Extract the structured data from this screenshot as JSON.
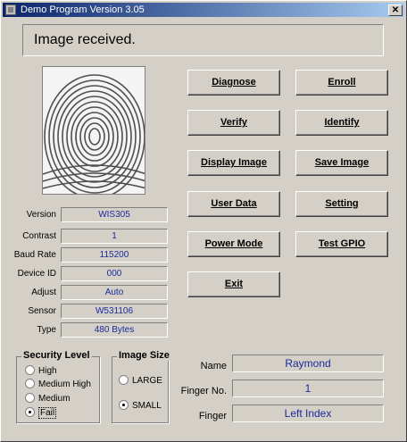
{
  "window": {
    "title": "Demo Program Version 3.05"
  },
  "status_message": "Image received.",
  "buttons": {
    "diagnose": "Diagnose",
    "enroll": "Enroll",
    "verify": "Verify",
    "identify": "Identify",
    "display_image": "Display Image",
    "save_image": "Save Image",
    "user_data": "User Data",
    "setting": "Setting",
    "power_mode": "Power Mode",
    "test_gpio": "Test GPIO",
    "exit": "Exit"
  },
  "device_info": [
    {
      "label": "Version",
      "value": "WIS305"
    },
    {
      "label": "Contrast",
      "value": "1"
    },
    {
      "label": "Baud Rate",
      "value": "115200"
    },
    {
      "label": "Device ID",
      "value": "000"
    },
    {
      "label": "Adjust",
      "value": "Auto"
    },
    {
      "label": "Sensor",
      "value": "W531106"
    },
    {
      "label": "Type",
      "value": "480 Bytes"
    }
  ],
  "security_level": {
    "title": "Security Level",
    "options": [
      "High",
      "Medium High",
      "Medium",
      "Fail"
    ],
    "selected": "Fail"
  },
  "image_size": {
    "title": "Image Size",
    "options": [
      "LARGE",
      "SMALL"
    ],
    "selected": "SMALL"
  },
  "user": {
    "name_label": "Name",
    "name": "Raymond",
    "finger_no_label": "Finger No.",
    "finger_no": "1",
    "finger_label": "Finger",
    "finger": "Left Index"
  },
  "colors": {
    "titlebar_start": "#0a246a",
    "field_text": "#1a2a9a",
    "face": "#d4d0c8"
  }
}
